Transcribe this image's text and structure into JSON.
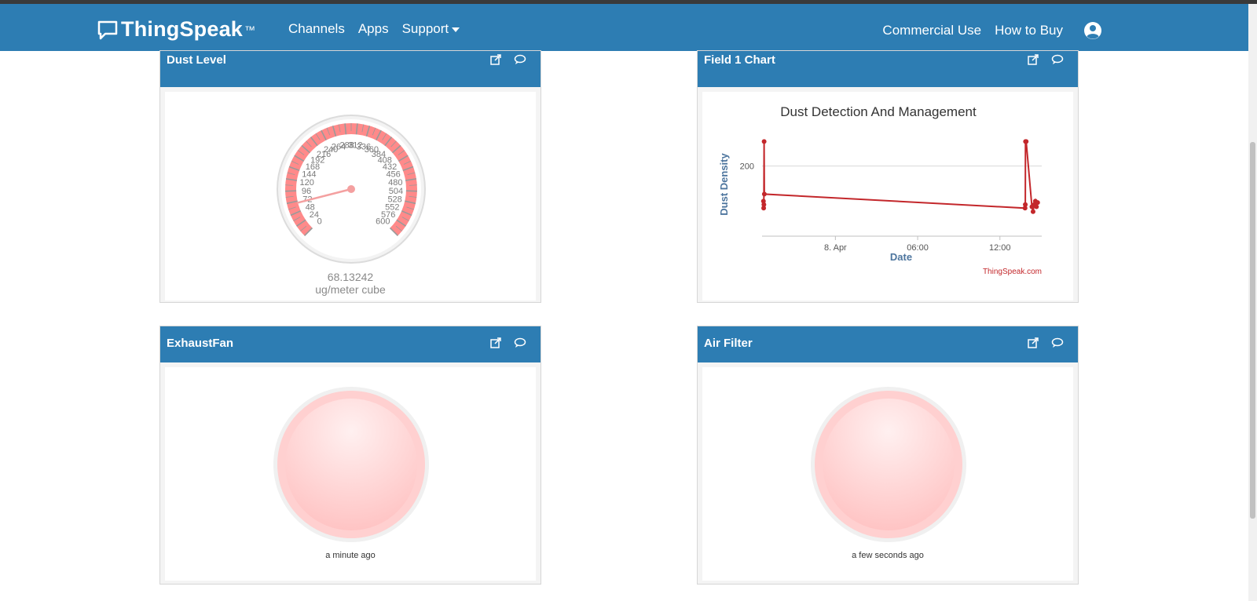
{
  "brand": {
    "name": "ThingSpeak",
    "tm": "™"
  },
  "nav": {
    "links": [
      "Channels",
      "Apps",
      "Support"
    ],
    "right": [
      "Commercial Use",
      "How to Buy"
    ]
  },
  "colors": {
    "nav": "#2d7db3",
    "series": "#c3272b",
    "lamp": "#ffc0c0"
  },
  "widgets": {
    "gauge": {
      "title": "Dust Level",
      "value": "68.13242",
      "numeric_value": 68.13242,
      "unit": "ug/meter cube",
      "min": 0,
      "max": 600,
      "ticks": [
        "0",
        "24",
        "48",
        "72",
        "96",
        "120",
        "144",
        "168",
        "192",
        "216",
        "240",
        "264",
        "288",
        "312",
        "336",
        "360",
        "384",
        "408",
        "432",
        "456",
        "480",
        "504",
        "528",
        "552",
        "576",
        "600"
      ]
    },
    "chart": {
      "title": "Field 1 Chart"
    },
    "lamp1": {
      "title": "ExhaustFan",
      "time": "a minute ago"
    },
    "lamp2": {
      "title": "Air Filter",
      "time": "a few seconds ago"
    }
  },
  "chart_data": {
    "type": "line",
    "title": "Dust Detection And Management",
    "xlabel": "Date",
    "ylabel": "Dust Density",
    "x_ticks": [
      "8. Apr",
      "06:00",
      "12:00"
    ],
    "y_ticks": [
      "200"
    ],
    "credit": "ThingSpeak.com",
    "series": [
      {
        "color": "#c3272b",
        "points": [
          {
            "x": "Apr 7 18:45",
            "y": 150
          },
          {
            "x": "Apr 7 18:46",
            "y": 140
          },
          {
            "x": "Apr 7 18:47",
            "y": 145
          },
          {
            "x": "Apr 7 18:48",
            "y": 235
          },
          {
            "x": "Apr 7 18:49",
            "y": 160
          },
          {
            "x": "Apr 8 13:50",
            "y": 140
          },
          {
            "x": "Apr 8 13:51",
            "y": 145
          },
          {
            "x": "Apr 8 13:52",
            "y": 235
          },
          {
            "x": "Apr 8 13:55",
            "y": 235
          },
          {
            "x": "Apr 8 14:20",
            "y": 142
          },
          {
            "x": "Apr 8 14:25",
            "y": 135
          },
          {
            "x": "Apr 8 14:30",
            "y": 145
          },
          {
            "x": "Apr 8 14:35",
            "y": 150
          },
          {
            "x": "Apr 8 14:40",
            "y": 142
          },
          {
            "x": "Apr 8 14:45",
            "y": 148
          }
        ]
      }
    ]
  }
}
